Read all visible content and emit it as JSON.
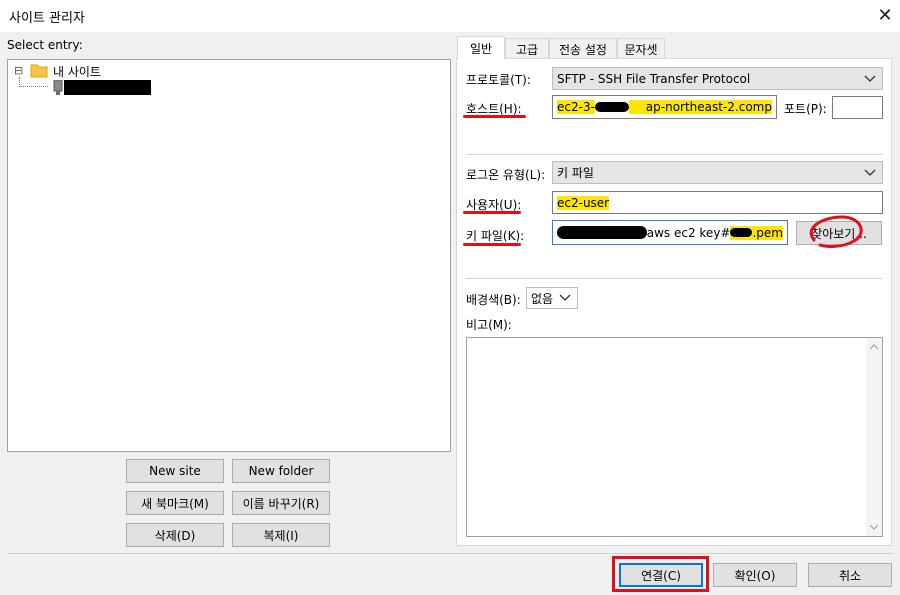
{
  "window": {
    "title": "사이트 관리자",
    "close_glyph": "✕"
  },
  "left": {
    "select_entry_label": "Select entry:",
    "tree": {
      "folder_label": "내 사이트",
      "expander_glyph": "⊟",
      "site_label": ""
    },
    "buttons": {
      "new_site": "New site",
      "new_folder": "New folder",
      "new_bookmark": "새 북마크(M)",
      "rename": "이름 바꾸기(R)",
      "delete": "삭제(D)",
      "duplicate": "복제(I)"
    }
  },
  "tabs": [
    "일반",
    "고급",
    "전송 설정",
    "문자셋"
  ],
  "general": {
    "protocol_label": "프로토콜(T):",
    "protocol_value": "SFTP - SSH File Transfer Protocol",
    "host_label": "호스트(H):",
    "host_value_prefix": "ec2-3-",
    "host_value_suffix": "ap-northeast-2.comp",
    "port_label": "포트(P):",
    "port_value": "",
    "logon_type_label": "로그온 유형(L):",
    "logon_type_value": "키 파일",
    "user_label": "사용자(U):",
    "user_value": "ec2-user",
    "keyfile_label": "키 파일(K):",
    "keyfile_value_mid": "aws ec2 key#",
    "keyfile_value_ext": ".pem",
    "browse_button": "찾아보기...",
    "bgcolor_label": "배경색(B):",
    "bgcolor_value": "없음",
    "comments_label": "비고(M):",
    "comments_value": ""
  },
  "footer": {
    "connect": "연결(C)",
    "ok": "확인(O)",
    "cancel": "취소"
  },
  "colors": {
    "highlight": "#ffe600",
    "annotation_red": "#e0101a",
    "folder": "#f4c542"
  },
  "icons": [
    "folder-icon",
    "server-icon",
    "chevron-down-icon",
    "close-icon",
    "scroll-up-icon",
    "scroll-down-icon"
  ]
}
